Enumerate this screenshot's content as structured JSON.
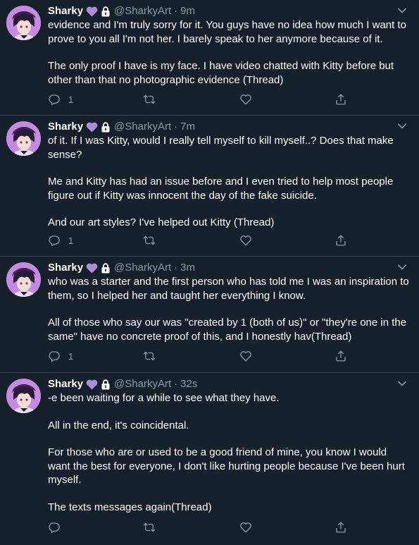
{
  "colors": {
    "background": "#15202b",
    "divider": "#38444d",
    "secondary_text": "#8899a6",
    "heart_purple": "#aa8ed6"
  },
  "icons": {
    "avatar": "avatar-image",
    "badge": "purple-heart-icon",
    "protected": "lock-icon",
    "menu": "chevron-down-icon",
    "reply": "reply-icon",
    "retweet": "retweet-icon",
    "like": "like-icon",
    "share": "share-icon"
  },
  "tweets": [
    {
      "name": "Sharky",
      "handle": "@SharkyArt",
      "separator": "·",
      "time": "9m",
      "paragraphs": [
        "evidence and I'm truly sorry for it. You guys have no idea how much I want to prove to you all I'm not her. I barely speak to her anymore because of it.",
        "The only proof I have is my face. I have video chatted with Kitty before but other than that no photographic evidence (Thread)"
      ],
      "reply_count": "1"
    },
    {
      "name": "Sharky",
      "handle": "@SharkyArt",
      "separator": "·",
      "time": "7m",
      "paragraphs": [
        "of it. If I was Kitty, would I really tell myself to kill myself..? Does that make sense?",
        "Me and Kitty has had an issue before and I even tried to help most people figure out if Kitty was innocent the day of the fake suicide.",
        "And our art styles? I've helped out Kitty (Thread)"
      ],
      "reply_count": "1"
    },
    {
      "name": "Sharky",
      "handle": "@SharkyArt",
      "separator": "·",
      "time": "3m",
      "paragraphs": [
        "who was a starter and the first person who has told me I was an inspiration to them, so I helped her and taught her everything I know.",
        "All of those who say our was \"created by 1 (both of us)\" or \"they're one in the same\" have no concrete proof of this, and I honestly hav(Thread)"
      ],
      "reply_count": "1"
    },
    {
      "name": "Sharky",
      "handle": "@SharkyArt",
      "separator": "·",
      "time": "32s",
      "paragraphs": [
        "-e been waiting for a while to see what they have.",
        "All in the end, it's coincidental.",
        "For those who are or used to be a good friend of mine, you know I would want the best for everyone, I don't like hurting people because I've been hurt myself.",
        "The texts messages again(Thread)"
      ],
      "reply_count": ""
    }
  ]
}
